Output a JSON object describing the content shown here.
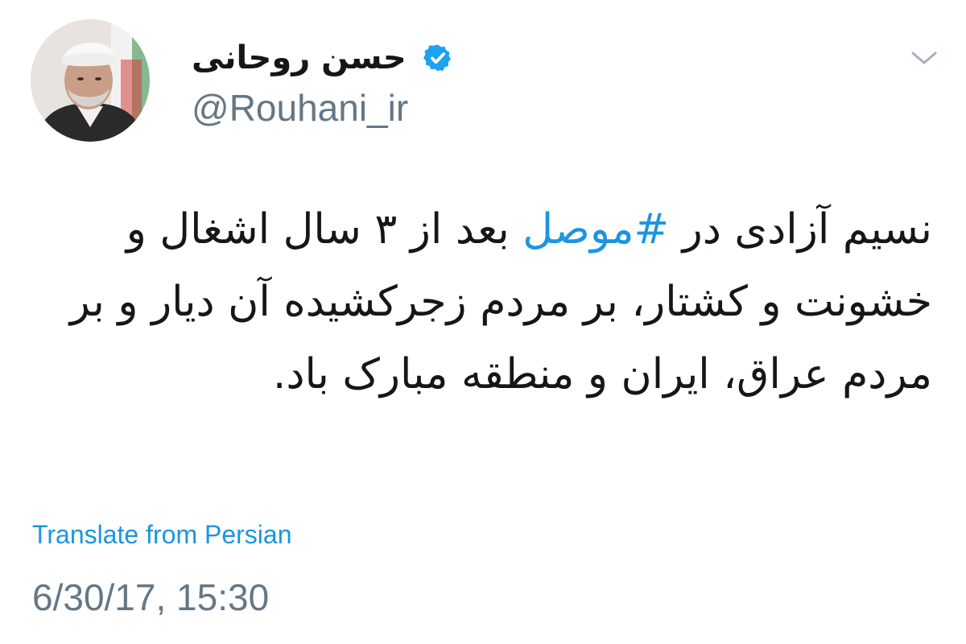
{
  "author": {
    "display_name": "حسن روحانی",
    "handle": "@Rouhani_ir",
    "verified": true,
    "avatar": "profile-photo"
  },
  "tweet": {
    "text_before_hashtag": "نسیم آزادی در ",
    "hashtag": "#موصل",
    "text_after_hashtag": " بعد از ۳ سال اشغال و خشونت و کشتار، بر مردم زجرکشیده آن دیار و بر مردم عراق، ایران و منطقه مبارک باد."
  },
  "translate_label": "Translate from Persian",
  "timestamp": "6/30/17, 15:30",
  "icons": {
    "verified": "verified-badge-icon",
    "menu": "chevron-down-icon"
  },
  "colors": {
    "link": "#1b95e0",
    "secondary_text": "#657786",
    "primary_text": "#14171a",
    "verified_badge": "#1da1f2"
  }
}
